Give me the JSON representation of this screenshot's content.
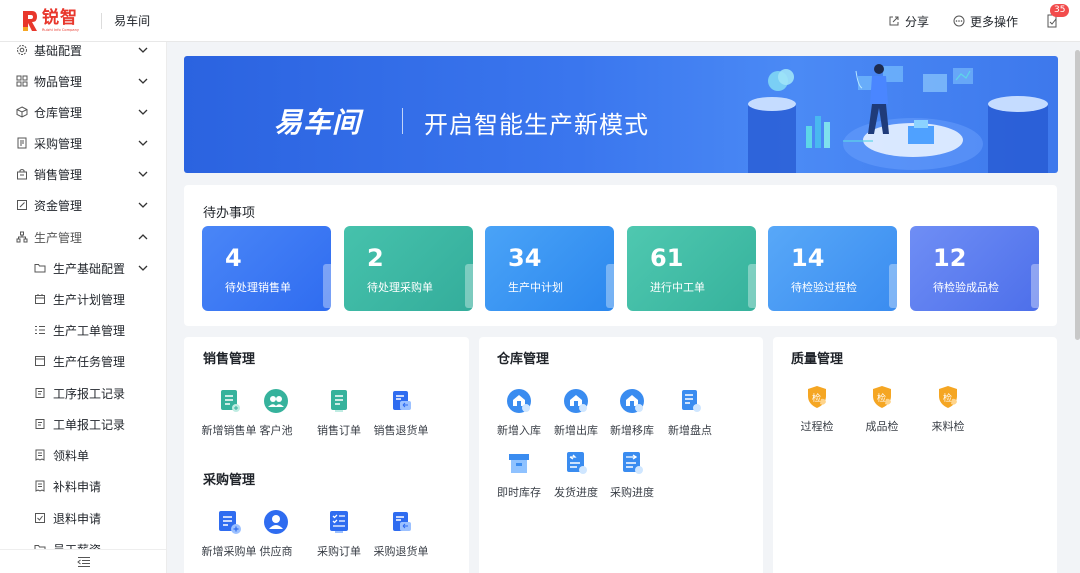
{
  "topbar": {
    "logo_name": "锐智",
    "logo_sub": "Ruizhi Info Company",
    "app_name": "易车间",
    "share_label": "分享",
    "more_label": "更多操作",
    "badge_count": "35"
  },
  "sidebar": {
    "items": [
      {
        "label": "基础配置",
        "icon": "gear-icon",
        "chevron": "down"
      },
      {
        "label": "物品管理",
        "icon": "grid-icon",
        "chevron": "down"
      },
      {
        "label": "仓库管理",
        "icon": "cube-icon",
        "chevron": "down"
      },
      {
        "label": "采购管理",
        "icon": "doc-icon",
        "chevron": "down"
      },
      {
        "label": "销售管理",
        "icon": "bag-icon",
        "chevron": "down"
      },
      {
        "label": "资金管理",
        "icon": "edit-icon",
        "chevron": "down"
      },
      {
        "label": "生产管理",
        "icon": "org-icon",
        "chevron": "up"
      }
    ],
    "sub_items": [
      {
        "label": "生产基础配置",
        "icon": "folder-icon",
        "chevron": "down"
      },
      {
        "label": "生产计划管理",
        "icon": "calendar-icon"
      },
      {
        "label": "生产工单管理",
        "icon": "list-icon"
      },
      {
        "label": "生产任务管理",
        "icon": "window-icon"
      },
      {
        "label": "工序报工记录",
        "icon": "clipboard-icon"
      },
      {
        "label": "工单报工记录",
        "icon": "clipboard-icon"
      },
      {
        "label": "领料单",
        "icon": "receipt-icon"
      },
      {
        "label": "补料申请",
        "icon": "receipt-icon"
      },
      {
        "label": "退料申请",
        "icon": "check-box-icon"
      },
      {
        "label": "员工薪资",
        "icon": "folder-icon"
      }
    ]
  },
  "banner": {
    "title": "易车间",
    "slogan": "开启智能生产新模式"
  },
  "todo": {
    "title": "待办事项",
    "cards": [
      {
        "value": "4",
        "label": "待处理销售单"
      },
      {
        "value": "2",
        "label": "待处理采购单"
      },
      {
        "value": "34",
        "label": "生产中计划"
      },
      {
        "value": "61",
        "label": "进行中工单"
      },
      {
        "value": "14",
        "label": "待检验过程检"
      },
      {
        "value": "12",
        "label": "待检验成品检"
      }
    ]
  },
  "sales": {
    "title": "销售管理",
    "actions": [
      "新增销售单",
      "客户池",
      "销售订单",
      "销售退货单"
    ]
  },
  "purchase": {
    "title": "采购管理",
    "actions": [
      "新增采购单",
      "供应商",
      "采购订单",
      "采购退货单"
    ]
  },
  "warehouse": {
    "title": "仓库管理",
    "actions": [
      "新增入库",
      "新增出库",
      "新增移库",
      "新增盘点",
      "即时库存",
      "发货进度",
      "采购进度"
    ]
  },
  "quality": {
    "title": "质量管理",
    "actions": [
      "过程检",
      "成品检",
      "来料检"
    ],
    "badge_text": "检"
  },
  "colors": {
    "accent": "#2f6cf0",
    "teal": "#36b29c",
    "orange": "#f5a623",
    "logo_red": "#e8372c"
  }
}
